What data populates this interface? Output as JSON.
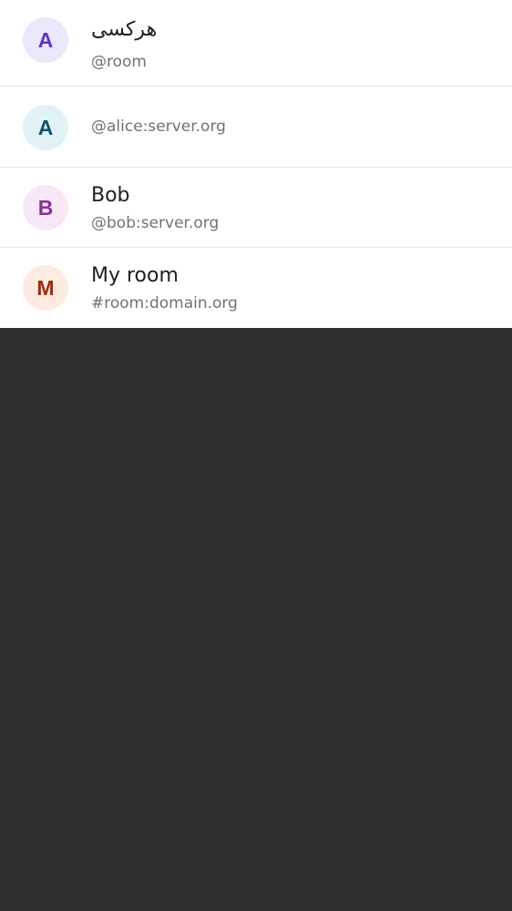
{
  "suggestions": [
    {
      "avatar_letter": "A",
      "avatar_bg": "#ece8fb",
      "avatar_fg": "#5d33c9",
      "title": "هرکسی",
      "subtitle": "@room"
    },
    {
      "avatar_letter": "A",
      "avatar_bg": "#e1f2f7",
      "avatar_fg": "#0c5471",
      "title": "",
      "subtitle": "@alice:server.org"
    },
    {
      "avatar_letter": "B",
      "avatar_bg": "#f8e8f7",
      "avatar_fg": "#8e2d9c",
      "title": "Bob",
      "subtitle": "@bob:server.org"
    },
    {
      "avatar_letter": "M",
      "avatar_bg": "#fdebe1",
      "avatar_fg": "#a22a0c",
      "title": "My room",
      "subtitle": "#room:domain.org"
    }
  ],
  "colors": {
    "list_background": "#ffffff",
    "divider": "#e6e6e6",
    "backdrop": "#303030",
    "title_text": "#1f1f1f",
    "subtitle_text": "#6c727a"
  }
}
